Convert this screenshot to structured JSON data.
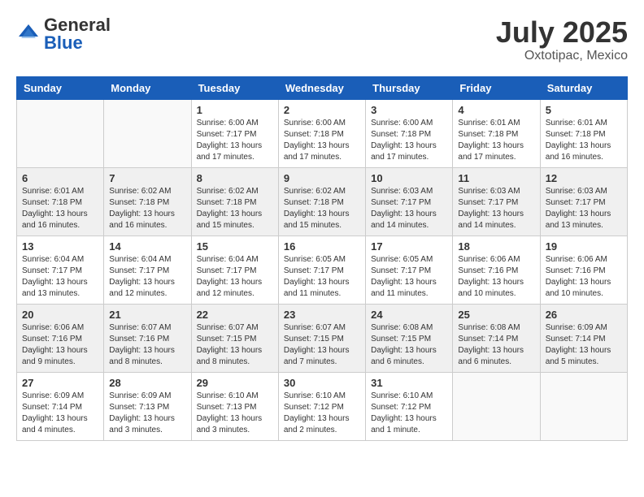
{
  "header": {
    "logo_general": "General",
    "logo_blue": "Blue",
    "month": "July 2025",
    "location": "Oxtotipac, Mexico"
  },
  "weekdays": [
    "Sunday",
    "Monday",
    "Tuesday",
    "Wednesday",
    "Thursday",
    "Friday",
    "Saturday"
  ],
  "weeks": [
    [
      {
        "day": "",
        "info": ""
      },
      {
        "day": "",
        "info": ""
      },
      {
        "day": "1",
        "info": "Sunrise: 6:00 AM\nSunset: 7:17 PM\nDaylight: 13 hours and 17 minutes."
      },
      {
        "day": "2",
        "info": "Sunrise: 6:00 AM\nSunset: 7:18 PM\nDaylight: 13 hours and 17 minutes."
      },
      {
        "day": "3",
        "info": "Sunrise: 6:00 AM\nSunset: 7:18 PM\nDaylight: 13 hours and 17 minutes."
      },
      {
        "day": "4",
        "info": "Sunrise: 6:01 AM\nSunset: 7:18 PM\nDaylight: 13 hours and 17 minutes."
      },
      {
        "day": "5",
        "info": "Sunrise: 6:01 AM\nSunset: 7:18 PM\nDaylight: 13 hours and 16 minutes."
      }
    ],
    [
      {
        "day": "6",
        "info": "Sunrise: 6:01 AM\nSunset: 7:18 PM\nDaylight: 13 hours and 16 minutes."
      },
      {
        "day": "7",
        "info": "Sunrise: 6:02 AM\nSunset: 7:18 PM\nDaylight: 13 hours and 16 minutes."
      },
      {
        "day": "8",
        "info": "Sunrise: 6:02 AM\nSunset: 7:18 PM\nDaylight: 13 hours and 15 minutes."
      },
      {
        "day": "9",
        "info": "Sunrise: 6:02 AM\nSunset: 7:18 PM\nDaylight: 13 hours and 15 minutes."
      },
      {
        "day": "10",
        "info": "Sunrise: 6:03 AM\nSunset: 7:17 PM\nDaylight: 13 hours and 14 minutes."
      },
      {
        "day": "11",
        "info": "Sunrise: 6:03 AM\nSunset: 7:17 PM\nDaylight: 13 hours and 14 minutes."
      },
      {
        "day": "12",
        "info": "Sunrise: 6:03 AM\nSunset: 7:17 PM\nDaylight: 13 hours and 13 minutes."
      }
    ],
    [
      {
        "day": "13",
        "info": "Sunrise: 6:04 AM\nSunset: 7:17 PM\nDaylight: 13 hours and 13 minutes."
      },
      {
        "day": "14",
        "info": "Sunrise: 6:04 AM\nSunset: 7:17 PM\nDaylight: 13 hours and 12 minutes."
      },
      {
        "day": "15",
        "info": "Sunrise: 6:04 AM\nSunset: 7:17 PM\nDaylight: 13 hours and 12 minutes."
      },
      {
        "day": "16",
        "info": "Sunrise: 6:05 AM\nSunset: 7:17 PM\nDaylight: 13 hours and 11 minutes."
      },
      {
        "day": "17",
        "info": "Sunrise: 6:05 AM\nSunset: 7:17 PM\nDaylight: 13 hours and 11 minutes."
      },
      {
        "day": "18",
        "info": "Sunrise: 6:06 AM\nSunset: 7:16 PM\nDaylight: 13 hours and 10 minutes."
      },
      {
        "day": "19",
        "info": "Sunrise: 6:06 AM\nSunset: 7:16 PM\nDaylight: 13 hours and 10 minutes."
      }
    ],
    [
      {
        "day": "20",
        "info": "Sunrise: 6:06 AM\nSunset: 7:16 PM\nDaylight: 13 hours and 9 minutes."
      },
      {
        "day": "21",
        "info": "Sunrise: 6:07 AM\nSunset: 7:16 PM\nDaylight: 13 hours and 8 minutes."
      },
      {
        "day": "22",
        "info": "Sunrise: 6:07 AM\nSunset: 7:15 PM\nDaylight: 13 hours and 8 minutes."
      },
      {
        "day": "23",
        "info": "Sunrise: 6:07 AM\nSunset: 7:15 PM\nDaylight: 13 hours and 7 minutes."
      },
      {
        "day": "24",
        "info": "Sunrise: 6:08 AM\nSunset: 7:15 PM\nDaylight: 13 hours and 6 minutes."
      },
      {
        "day": "25",
        "info": "Sunrise: 6:08 AM\nSunset: 7:14 PM\nDaylight: 13 hours and 6 minutes."
      },
      {
        "day": "26",
        "info": "Sunrise: 6:09 AM\nSunset: 7:14 PM\nDaylight: 13 hours and 5 minutes."
      }
    ],
    [
      {
        "day": "27",
        "info": "Sunrise: 6:09 AM\nSunset: 7:14 PM\nDaylight: 13 hours and 4 minutes."
      },
      {
        "day": "28",
        "info": "Sunrise: 6:09 AM\nSunset: 7:13 PM\nDaylight: 13 hours and 3 minutes."
      },
      {
        "day": "29",
        "info": "Sunrise: 6:10 AM\nSunset: 7:13 PM\nDaylight: 13 hours and 3 minutes."
      },
      {
        "day": "30",
        "info": "Sunrise: 6:10 AM\nSunset: 7:12 PM\nDaylight: 13 hours and 2 minutes."
      },
      {
        "day": "31",
        "info": "Sunrise: 6:10 AM\nSunset: 7:12 PM\nDaylight: 13 hours and 1 minute."
      },
      {
        "day": "",
        "info": ""
      },
      {
        "day": "",
        "info": ""
      }
    ]
  ]
}
